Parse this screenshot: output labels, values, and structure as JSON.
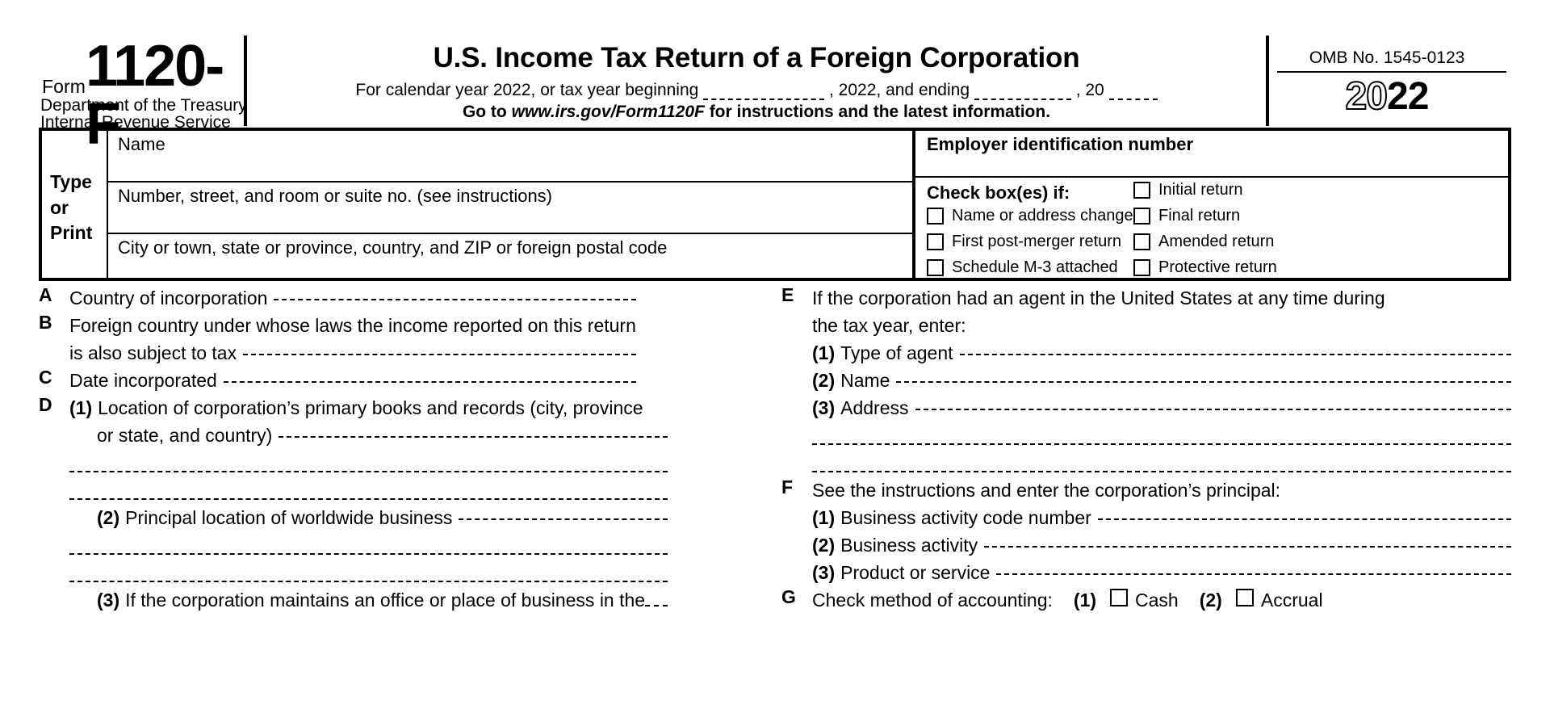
{
  "header": {
    "form_word": "Form",
    "form_number": "1120-F",
    "department_line1": "Department of the Treasury",
    "department_line2": "Internal Revenue Service",
    "title": "U.S. Income Tax Return of a Foreign Corporation",
    "calendar_prefix": "For calendar year 2022, or tax year beginning",
    "calendar_mid": ", 2022, and ending",
    "calendar_suffix": ", 20",
    "go_to_prefix": "Go to",
    "go_to_url": "www.irs.gov/Form1120F",
    "go_to_suffix": "for instructions and the latest information.",
    "omb": "OMB No. 1545-0123",
    "year_hollow": "20",
    "year_solid": "22"
  },
  "address_block": {
    "type_or_print": [
      "Type",
      "or",
      "Print"
    ],
    "name_label": "Name",
    "street_label": "Number, street, and room or suite no. (see instructions)",
    "city_label": "City or town, state or province, country, and ZIP or foreign postal code",
    "ein_label": "Employer identification number",
    "check_boxes_title": "Check box(es) if:",
    "checkboxes_left": [
      "Name or address change",
      "First post-merger return",
      "Schedule M-3 attached"
    ],
    "checkboxes_right": [
      "Initial return",
      "Final return",
      "Amended return",
      "Protective return"
    ]
  },
  "left_items": {
    "A": {
      "letter": "A",
      "text": "Country of incorporation"
    },
    "B": {
      "letter": "B",
      "text_line1": "Foreign country under whose laws the income reported on this return",
      "text_line2": "is also subject to tax"
    },
    "C": {
      "letter": "C",
      "text": "Date incorporated"
    },
    "D": {
      "letter": "D",
      "sub1_num": "(1)",
      "sub1_line1": "Location of corporation’s primary books and records (city, province",
      "sub1_line2": "or state, and country)",
      "sub2_num": "(2)",
      "sub2_text": "Principal location of worldwide business",
      "sub3_num": "(3)",
      "sub3_text": "If the corporation maintains an office or place of business in the"
    }
  },
  "right_items": {
    "E": {
      "letter": "E",
      "text_line1": "If the corporation had an agent in the United States at any time during",
      "text_line2": "the tax year, enter:",
      "sub1_num": "(1)",
      "sub1_text": "Type of agent",
      "sub2_num": "(2)",
      "sub2_text": "Name",
      "sub3_num": "(3)",
      "sub3_text": "Address"
    },
    "F": {
      "letter": "F",
      "text": "See the instructions and enter the corporation’s principal:",
      "sub1_num": "(1)",
      "sub1_text": "Business activity code number",
      "sub2_num": "(2)",
      "sub2_text": "Business activity",
      "sub3_num": "(3)",
      "sub3_text": "Product or service"
    },
    "G": {
      "letter": "G",
      "text": "Check method of accounting:",
      "opt1_num": "(1)",
      "opt1_text": "Cash",
      "opt2_num": "(2)",
      "opt2_text": "Accrual"
    }
  }
}
